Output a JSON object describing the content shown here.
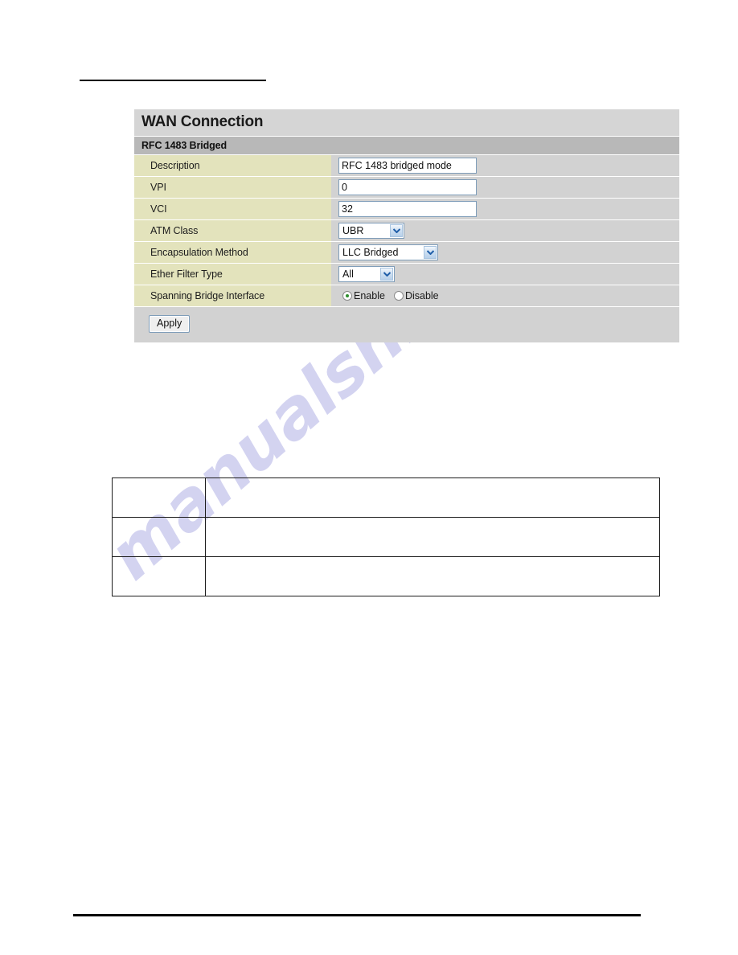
{
  "page": {
    "watermark": "manualshive.com",
    "top_rule": true,
    "bottom_rule": true
  },
  "panel": {
    "title": "WAN Connection",
    "subtitle": "RFC 1483 Bridged",
    "rows": [
      {
        "label": "Description",
        "type": "text",
        "value": "RFC 1483 bridged mode"
      },
      {
        "label": "VPI",
        "type": "text",
        "value": "0"
      },
      {
        "label": "VCI",
        "type": "text",
        "value": "32"
      },
      {
        "label": "ATM Class",
        "type": "select",
        "value": "UBR"
      },
      {
        "label": "Encapsulation Method",
        "type": "select",
        "value": "LLC Bridged"
      },
      {
        "label": "Ether Filter Type",
        "type": "select",
        "value": "All"
      },
      {
        "label": "Spanning Bridge Interface",
        "type": "radio"
      }
    ],
    "radio": {
      "enable_label": "Enable",
      "disable_label": "Disable",
      "selected": "Enable"
    },
    "apply_label": "Apply",
    "colors": {
      "title_bar": "#d5d5d5",
      "subtitle_bar": "#b8b8b8",
      "label_cell": "#e3e3bc",
      "field_cell": "#d2d2d2",
      "input_border": "#7f9db9",
      "radio_selected": "#2f8f2f",
      "watermark": "#b9b9e8"
    }
  },
  "description_table": {
    "rows": [
      {
        "key": "",
        "value": ""
      },
      {
        "key": "",
        "value": ""
      },
      {
        "key": "",
        "value": ""
      }
    ]
  }
}
